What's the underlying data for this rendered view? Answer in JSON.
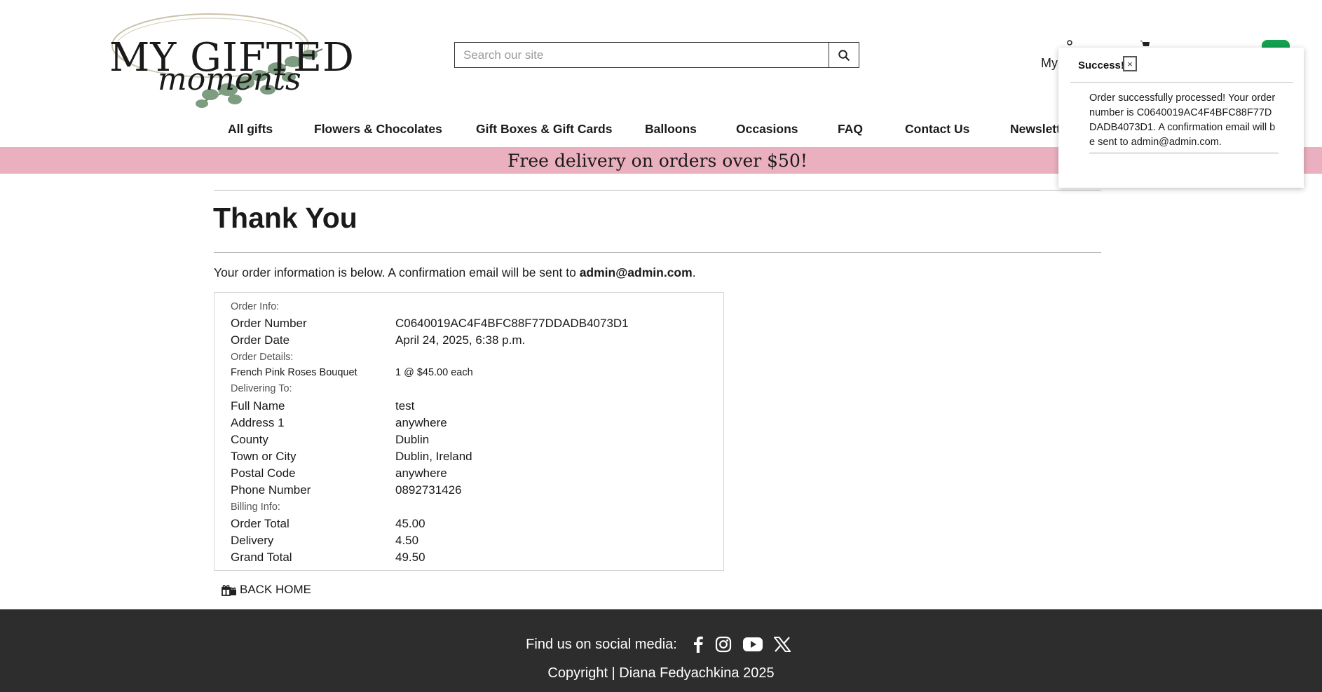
{
  "header": {
    "brand_main": "MY GIFTED",
    "brand_sub": "moments",
    "search_placeholder": "Search our site",
    "account_label": "My Ac"
  },
  "nav": {
    "items": [
      {
        "label": "All gifts"
      },
      {
        "label": "Flowers & Chocolates"
      },
      {
        "label": "Gift Boxes & Gift Cards"
      },
      {
        "label": "Balloons"
      },
      {
        "label": "Occasions"
      },
      {
        "label": "FAQ"
      },
      {
        "label": "Contact Us"
      },
      {
        "label": "Newsletter"
      }
    ]
  },
  "banner": {
    "text": "Free delivery on orders over $50!"
  },
  "main": {
    "title": "Thank You",
    "intro_prefix": "Your order information is below. A confirmation email will be sent to ",
    "intro_email": "admin@admin.com",
    "intro_suffix": "."
  },
  "order": {
    "order_info_label": "Order Info:",
    "order_number_label": "Order Number",
    "order_number": "C0640019AC4F4BFC88F77DDADB4073D1",
    "order_date_label": "Order Date",
    "order_date": "April 24, 2025, 6:38 p.m.",
    "order_details_label": "Order Details:",
    "item_name": "French Pink Roses Bouquet",
    "item_qty_price": "1 @ $45.00 each",
    "delivering_label": "Delivering To:",
    "full_name_label": "Full Name",
    "full_name": "test",
    "address1_label": "Address 1",
    "address1": "anywhere",
    "county_label": "County",
    "county": "Dublin",
    "town_label": "Town or City",
    "town": "Dublin, Ireland",
    "postal_label": "Postal Code",
    "postal": "anywhere",
    "phone_label": "Phone Number",
    "phone": "0892731426",
    "billing_label": "Billing Info:",
    "order_total_label": "Order Total",
    "order_total": "45.00",
    "delivery_label": "Delivery",
    "delivery": "4.50",
    "grand_total_label": "Grand Total",
    "grand_total": "49.50"
  },
  "back_home": {
    "label": "BACK HOME"
  },
  "toast": {
    "title": "Success!",
    "close": "×",
    "message": "Order successfully processed! Your order number is C0640019AC4F4BFC88F77DDADB4073D1. A confirmation email will be sent to admin@admin.com."
  },
  "footer": {
    "social_label": "Find us on social media:",
    "icons": [
      "facebook-icon",
      "instagram-icon",
      "youtube-icon",
      "x-icon"
    ],
    "copyright": "Copyright | Diana Fedyachkina 2025"
  },
  "colors": {
    "banner": "#ebb0c0",
    "footer": "#2d2d2d",
    "cart_accent": "#12a150"
  }
}
